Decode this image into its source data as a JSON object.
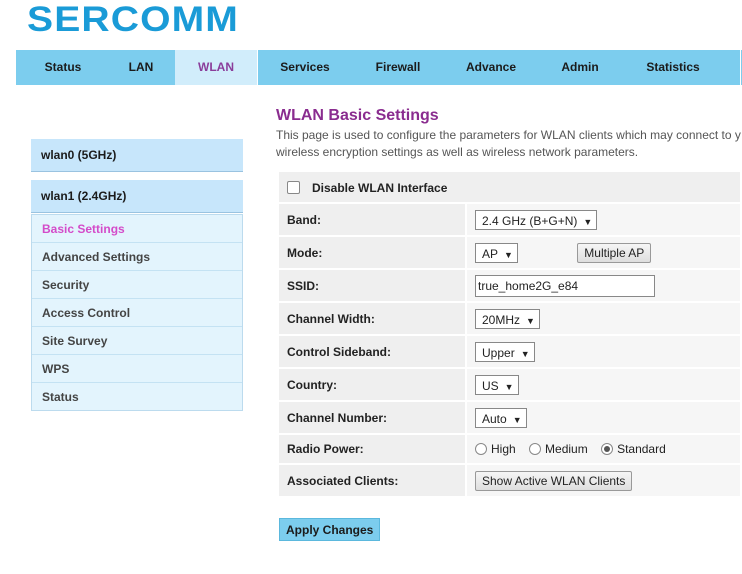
{
  "brand": {
    "logo_text": "SERCOMM",
    "color": "#1a9bd7"
  },
  "nav": {
    "tabs": [
      {
        "label": "Status"
      },
      {
        "label": "LAN"
      },
      {
        "label": "WLAN"
      },
      {
        "label": "Services"
      },
      {
        "label": "Firewall"
      },
      {
        "label": "Advance"
      },
      {
        "label": "Admin"
      },
      {
        "label": "Statistics"
      }
    ],
    "active": "WLAN",
    "bar_color": "#7ccdee",
    "active_color": "#d1edfb"
  },
  "page": {
    "title": "WLAN Basic Settings",
    "description_line1": "This page is used to configure the parameters for WLAN clients which may connect to y",
    "description_line2": "wireless encryption settings as well as wireless network parameters."
  },
  "sidebar": {
    "groups": [
      {
        "label": "wlan0 (5GHz)"
      },
      {
        "label": "wlan1 (2.4GHz)"
      }
    ],
    "items": [
      {
        "label": "Basic Settings"
      },
      {
        "label": "Advanced Settings"
      },
      {
        "label": "Security"
      },
      {
        "label": "Access Control"
      },
      {
        "label": "Site Survey"
      },
      {
        "label": "WPS"
      },
      {
        "label": "Status"
      }
    ],
    "active_item": "Basic Settings"
  },
  "form": {
    "disable_wlan_label": "Disable WLAN Interface",
    "disable_wlan_checked": false,
    "band": {
      "label": "Band:",
      "value": "2.4 GHz (B+G+N)"
    },
    "mode": {
      "label": "Mode:",
      "value": "AP",
      "multiple_ap_button": "Multiple AP"
    },
    "ssid": {
      "label": "SSID:",
      "value": "true_home2G_e84"
    },
    "channel_width": {
      "label": "Channel Width:",
      "value": "20MHz"
    },
    "control_sideband": {
      "label": "Control Sideband:",
      "value": "Upper"
    },
    "country": {
      "label": "Country:",
      "value": "US"
    },
    "channel_number": {
      "label": "Channel Number:",
      "value": "Auto"
    },
    "radio_power": {
      "label": "Radio Power:",
      "options": [
        "High",
        "Medium",
        "Standard"
      ],
      "selected": "Standard"
    },
    "associated_clients": {
      "label": "Associated Clients:",
      "button": "Show Active WLAN Clients"
    }
  },
  "apply_button": "Apply Changes"
}
